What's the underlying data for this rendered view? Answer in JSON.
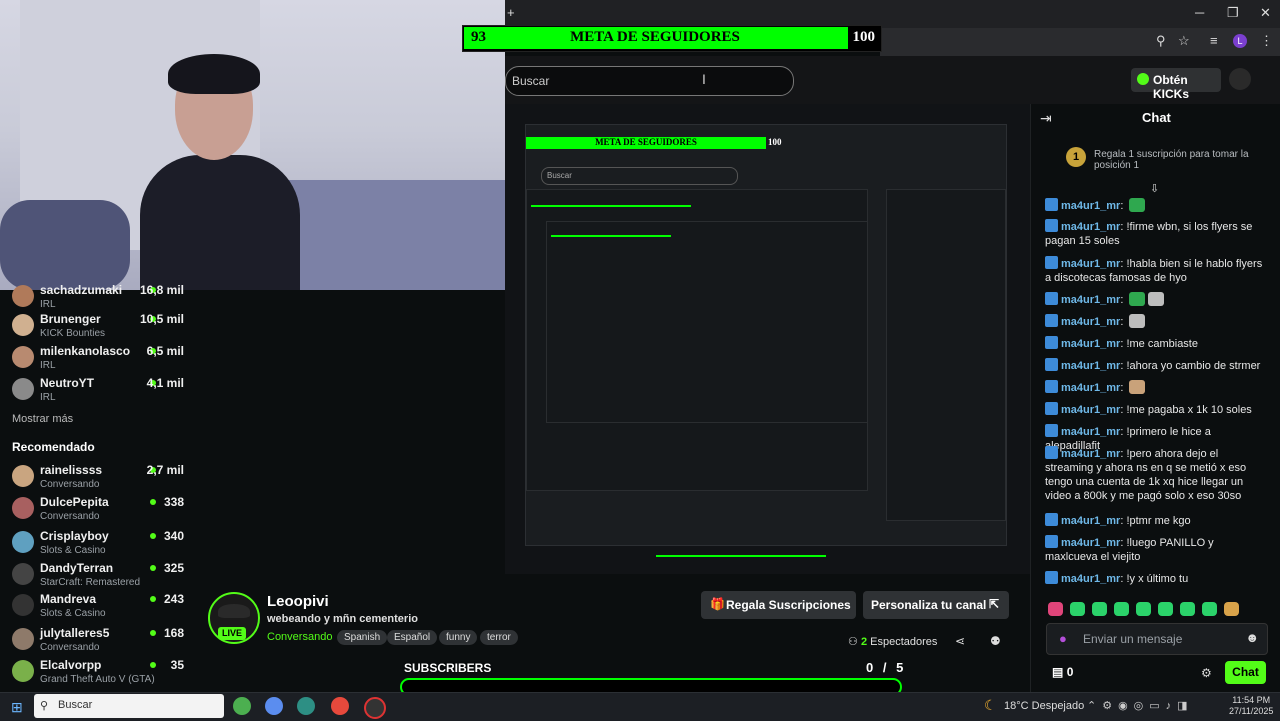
{
  "goal": {
    "current": "93",
    "title": "META DE SEGUIDORES",
    "target": "100",
    "fill_fraction": 0.93
  },
  "window": {
    "new_tab": "+",
    "minimize": "─",
    "restore": "❐",
    "close": "✕"
  },
  "header": {
    "search_placeholder": "Buscar",
    "kick_button": "Obtén KICKs"
  },
  "nested": {
    "goal_title": "META DE SEGUIDORES",
    "goal_target": "100",
    "search": "Buscar"
  },
  "sidebar": {
    "channels": [
      {
        "name": "sachadzumaki",
        "sub": "IRL",
        "viewers": "16,8 mil",
        "color": "#b07a5a"
      },
      {
        "name": "Brunenger",
        "sub": "KICK Bounties",
        "viewers": "10,5 mil",
        "color": "#d0b090"
      },
      {
        "name": "milenkanolasco",
        "sub": "IRL",
        "viewers": "6,5 mil",
        "color": "#b88a70"
      },
      {
        "name": "NeutroYT",
        "sub": "IRL",
        "viewers": "4,1 mil",
        "color": "#8a8a8a"
      }
    ],
    "show_more": "Mostrar más",
    "recommended_title": "Recomendado",
    "recommended": [
      {
        "name": "rainelissss",
        "sub": "Conversando",
        "viewers": "2,7 mil",
        "color": "#c9a580"
      },
      {
        "name": "DulcePepita",
        "sub": "Conversando",
        "viewers": "338",
        "color": "#a86060"
      },
      {
        "name": "Crisplayboy",
        "sub": "Slots & Casino",
        "viewers": "340",
        "color": "#5fa0c0"
      },
      {
        "name": "DandyTerran",
        "sub": "StarCraft: Remastered",
        "viewers": "325",
        "color": "#444"
      },
      {
        "name": "Mandreva",
        "sub": "Slots & Casino",
        "viewers": "243",
        "color": "#333"
      },
      {
        "name": "julytalleres5",
        "sub": "Conversando",
        "viewers": "168",
        "color": "#8e7a6a"
      },
      {
        "name": "Elcalvorpp",
        "sub": "Grand Theft Auto V (GTA)",
        "viewers": "35",
        "color": "#7ab04a"
      }
    ]
  },
  "channel": {
    "name": "Leoopivi",
    "title": "webeando y mñn cementerio",
    "category": "Conversando",
    "tags": [
      "Spanish",
      "Español",
      "funny",
      "terror"
    ],
    "live": "LIVE",
    "gift_button": "Regala Suscripciones",
    "customize_button": "Personaliza tu canal",
    "viewers_count": "2",
    "viewers_label": "Espectadores"
  },
  "subs": {
    "label": "SUBSCRIBERS",
    "count": "0 / 5",
    "fill_fraction": 0
  },
  "chat": {
    "title": "Chat",
    "gift_rank": "1",
    "gift_text": "Regala 1 suscripción para tomar la posición 1",
    "messages": [
      {
        "user": "ma4ur1_mr",
        "text": "",
        "emotes": [
          "#2fa84f"
        ]
      },
      {
        "user": "ma4ur1_mr",
        "text": "!firme wbn, si los flyers se pagan 15 soles",
        "emotes": []
      },
      {
        "user": "ma4ur1_mr",
        "text": "!habla bien si le hablo flyers a discotecas famosas de hyo",
        "emotes": []
      },
      {
        "user": "ma4ur1_mr",
        "text": "",
        "emotes": [
          "#2fa84f",
          "#bdbdbd"
        ]
      },
      {
        "user": "ma4ur1_mr",
        "text": "",
        "emotes": [
          "#bdbdbd"
        ]
      },
      {
        "user": "ma4ur1_mr",
        "text": "!me cambiaste",
        "emotes": []
      },
      {
        "user": "ma4ur1_mr",
        "text": "!ahora yo cambio de strmer",
        "emotes": []
      },
      {
        "user": "ma4ur1_mr",
        "text": "",
        "emotes": [
          "#c9a27a"
        ]
      },
      {
        "user": "ma4ur1_mr",
        "text": "!me pagaba x 1k 10 soles",
        "emotes": []
      },
      {
        "user": "ma4ur1_mr",
        "text": "!primero le hice a alepadillafit",
        "emotes": []
      },
      {
        "user": "ma4ur1_mr",
        "text": "!pero ahora dejo el streaming y ahora ns en q se metió x eso tengo una cuenta de 1k xq hice llegar un video a 800k y me pagó solo x eso 30so",
        "emotes": []
      },
      {
        "user": "ma4ur1_mr",
        "text": "!ptmr me kgo",
        "emotes": []
      },
      {
        "user": "ma4ur1_mr",
        "text": "!luego PANILLO y maxlcueva el viejito",
        "emotes": []
      },
      {
        "user": "ma4ur1_mr",
        "text": "!y x último tu",
        "emotes": []
      }
    ],
    "input_placeholder": "Enviar un mensaje",
    "points": "0",
    "send_button": "Chat"
  },
  "taskbar": {
    "search": "Buscar",
    "weather": "18°C  Despejado",
    "time": "11:54 PM",
    "date": "27/11/2025"
  },
  "colors": {
    "accent": "#53fc18",
    "goal_green": "#00ff00",
    "username": "#6fb9e9"
  }
}
